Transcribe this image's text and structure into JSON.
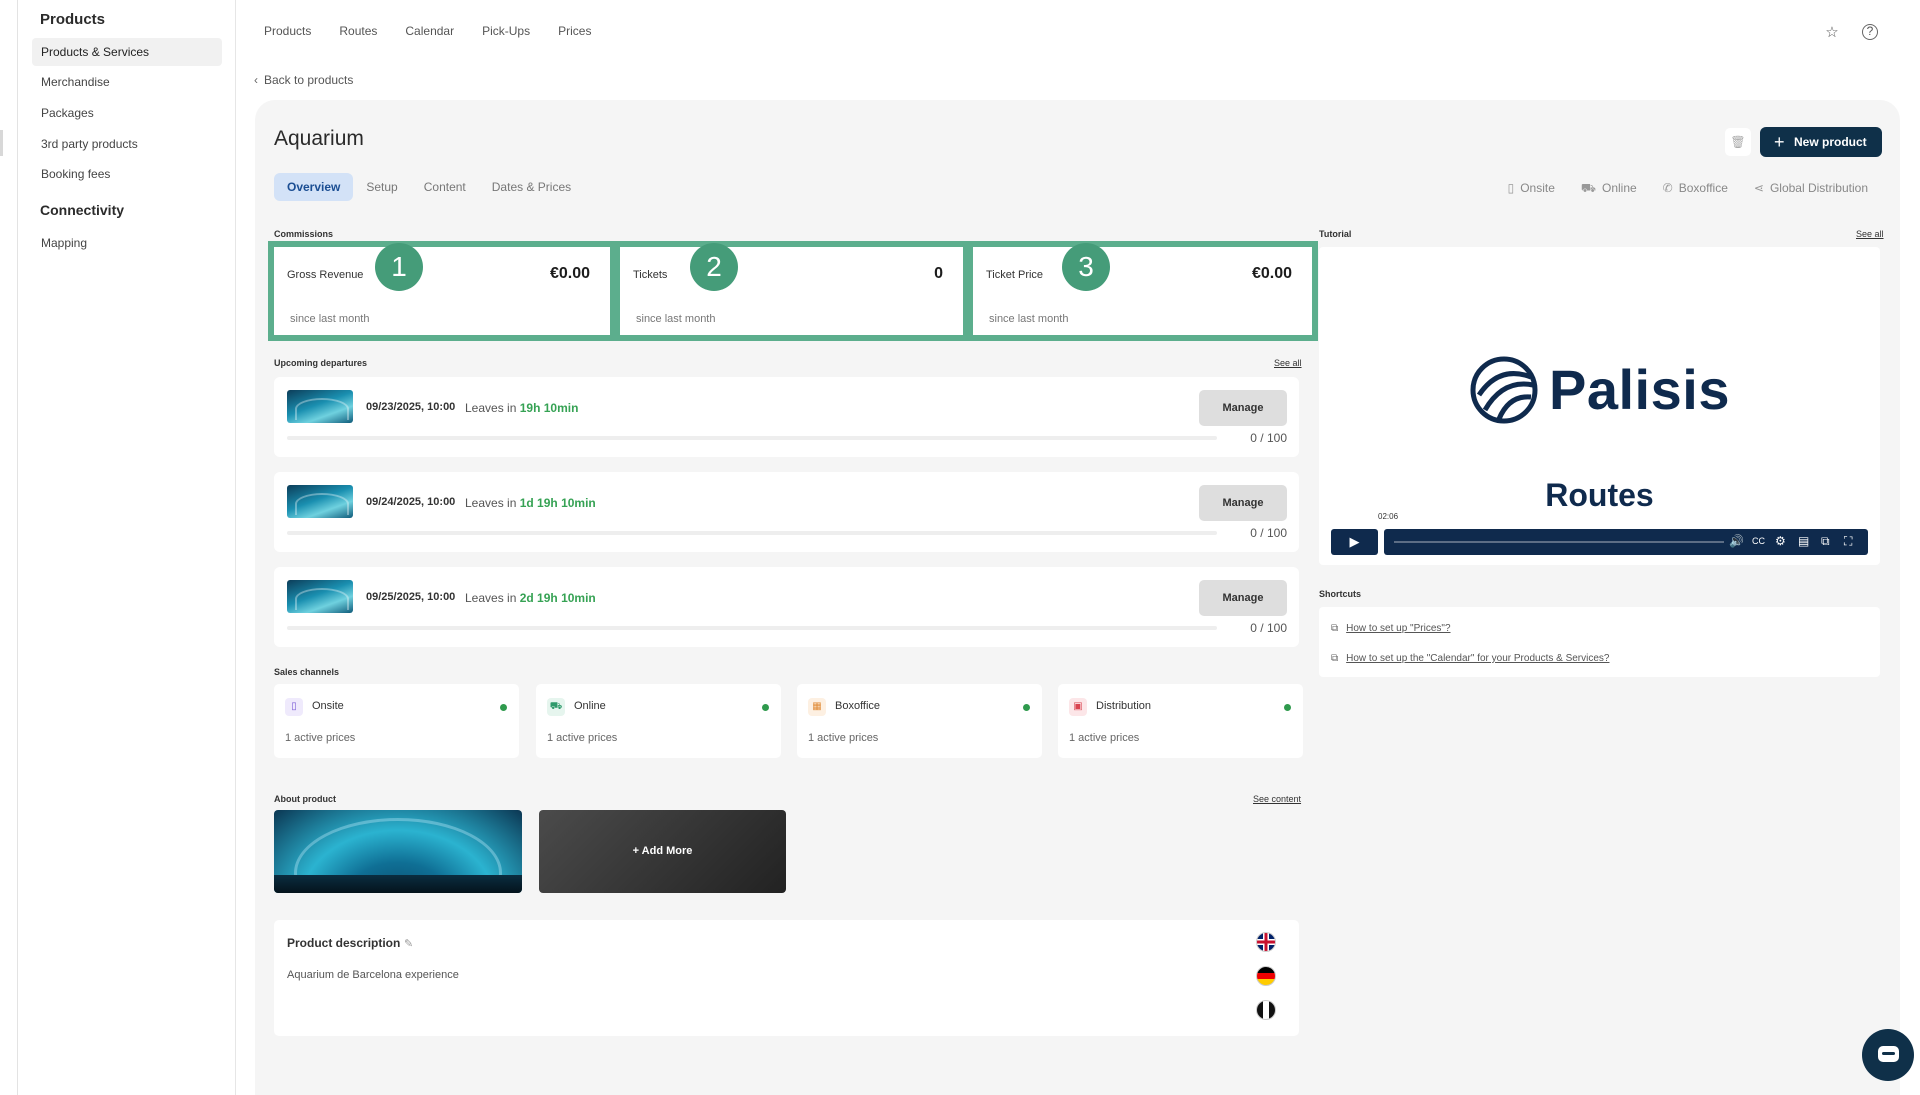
{
  "sidebar": {
    "section1": "Products",
    "items1": [
      "Products & Services",
      "Merchandise",
      "Packages",
      "3rd party products",
      "Booking fees"
    ],
    "section2": "Connectivity",
    "items2": [
      "Mapping"
    ]
  },
  "topnav": [
    "Products",
    "Routes",
    "Calendar",
    "Pick-Ups",
    "Prices"
  ],
  "back_label": "Back to products",
  "product_title": "Aquarium",
  "new_product_label": "New product",
  "tabs": [
    "Overview",
    "Setup",
    "Content",
    "Dates & Prices"
  ],
  "channel_links": [
    "Onsite",
    "Online",
    "Boxoffice",
    "Global Distribution"
  ],
  "commissions": {
    "label": "Commissions",
    "cards": [
      {
        "label": "Gross Revenue",
        "value": "€0.00",
        "sub": "since last month",
        "badge": "1"
      },
      {
        "label": "Tickets",
        "value": "0",
        "sub": "since last month",
        "badge": "2"
      },
      {
        "label": "Ticket Price",
        "value": "€0.00",
        "sub": "since last month",
        "badge": "3"
      }
    ]
  },
  "departures": {
    "label": "Upcoming departures",
    "see_all": "See all",
    "items": [
      {
        "date": "09/23/2025, 10:00",
        "leaves_prefix": "Leaves in",
        "leaves_time": "19h 10min",
        "manage": "Manage",
        "count": "0 / 100"
      },
      {
        "date": "09/24/2025, 10:00",
        "leaves_prefix": "Leaves in",
        "leaves_time": "1d 19h 10min",
        "manage": "Manage",
        "count": "0 / 100"
      },
      {
        "date": "09/25/2025, 10:00",
        "leaves_prefix": "Leaves in",
        "leaves_time": "2d 19h 10min",
        "manage": "Manage",
        "count": "0 / 100"
      }
    ]
  },
  "sales_channels": {
    "label": "Sales channels",
    "items": [
      {
        "name": "Onsite",
        "sub": "1 active prices",
        "icon": "phone-icon",
        "color": "#7a5bd6"
      },
      {
        "name": "Online",
        "sub": "1 active prices",
        "icon": "cart-icon",
        "color": "#2f9a6b"
      },
      {
        "name": "Boxoffice",
        "sub": "1 active prices",
        "icon": "store-icon",
        "color": "#e08a35"
      },
      {
        "name": "Distribution",
        "sub": "1 active prices",
        "icon": "distribution-icon",
        "color": "#d9434f"
      }
    ]
  },
  "about": {
    "label": "About product",
    "see_content": "See content",
    "add_more": "+ Add More"
  },
  "description": {
    "title": "Product description",
    "text": "Aquarium de Barcelona experience"
  },
  "tutorial": {
    "label": "Tutorial",
    "see_all": "See all",
    "brand": "Palisis",
    "video_title": "Routes",
    "time": "02:06"
  },
  "shortcuts": {
    "label": "Shortcuts",
    "links": [
      "How to set up \"Prices\"?",
      "How to set up the \"Calendar\" for your Products & Services?"
    ]
  }
}
